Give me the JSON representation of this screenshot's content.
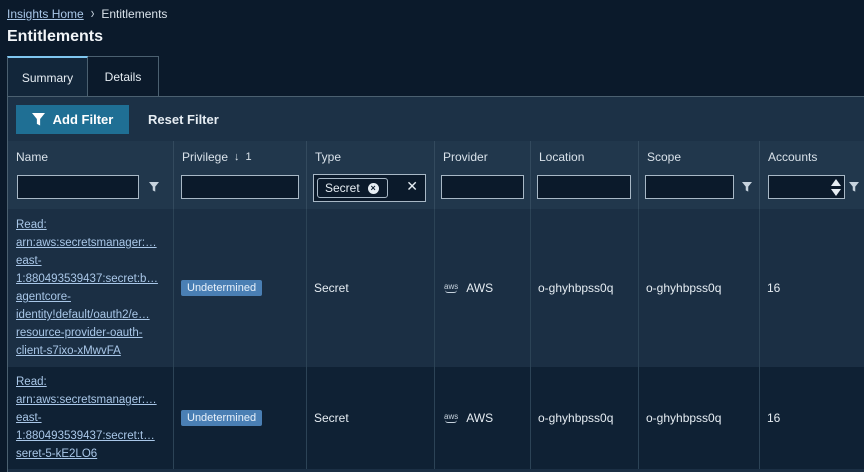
{
  "breadcrumb": {
    "home": "Insights Home",
    "current": "Entitlements"
  },
  "page_title": "Entitlements",
  "tabs": [
    {
      "label": "Summary",
      "active": true
    },
    {
      "label": "Details",
      "active": false
    }
  ],
  "toolbar": {
    "add_filter": "Add Filter",
    "reset_filter": "Reset Filter"
  },
  "columns": {
    "name": "Name",
    "privilege": "Privilege",
    "privilege_sort": "1",
    "type": "Type",
    "provider": "Provider",
    "location": "Location",
    "scope": "Scope",
    "accounts": "Accounts"
  },
  "filters": {
    "type_chip": "Secret"
  },
  "rows": [
    {
      "name": "Read:\narn:aws:secretsmanager:…\neast-\n1:880493539437:secret:b…\nagentcore-\nidentity!default/oauth2/e…\nresource-provider-oauth-\nclient-s7ixo-xMwvFA",
      "privilege": "Undetermined",
      "type": "Secret",
      "provider": "AWS",
      "location": "o-ghyhbpss0q",
      "scope": "o-ghyhbpss0q",
      "accounts": "16"
    },
    {
      "name": "Read:\narn:aws:secretsmanager:…\neast-\n1:880493539437:secret:t…\nseret-5-kE2LO6",
      "privilege": "Undetermined",
      "type": "Secret",
      "provider": "AWS",
      "location": "o-ghyhbpss0q",
      "scope": "o-ghyhbpss0q",
      "accounts": "16"
    }
  ],
  "icons": {
    "add_filter": "funnel-icon",
    "filter": "funnel-icon",
    "chip_remove": "circle-x-icon",
    "clear": "close-icon",
    "provider": "aws-logo-icon",
    "breadcrumb_sep": "chevron-right-icon",
    "sort": "arrow-down-icon"
  },
  "colors": {
    "accent": "#1f6f94",
    "badge": "#4a7fb4",
    "link": "#a9c7e8",
    "background": "#0b1a2b"
  }
}
